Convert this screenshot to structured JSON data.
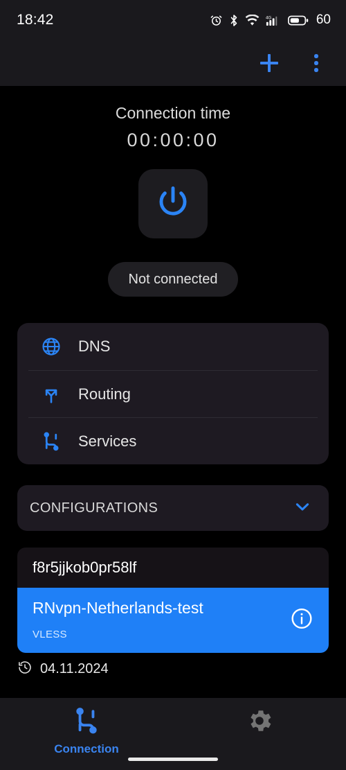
{
  "status_bar": {
    "time": "18:42",
    "battery_percent": "60",
    "icons": [
      "alarm-icon",
      "bluetooth-icon",
      "wifi-icon",
      "cellular-4g-icon",
      "battery-icon"
    ]
  },
  "app_bar": {
    "add_label": "+",
    "add_icon": "plus-icon",
    "overflow_icon": "kebab-menu-icon"
  },
  "connection": {
    "time_label": "Connection time",
    "time_value": "00:00:00",
    "power_icon": "power-icon",
    "status_text": "Not connected"
  },
  "menu": {
    "items": [
      {
        "label": "DNS",
        "icon": "globe-icon"
      },
      {
        "label": "Routing",
        "icon": "route-split-icon"
      },
      {
        "label": "Services",
        "icon": "cable-connection-icon"
      }
    ]
  },
  "configurations": {
    "header_label": "CONFIGURATIONS",
    "expand_icon": "chevron-down-icon",
    "items": [
      {
        "title": "f8r5jjkob0pr58lf",
        "protocol": "",
        "selected": false
      },
      {
        "title": "RNvpn-Netherlands-test",
        "protocol": "VLESS",
        "selected": true,
        "info_icon": "info-circle-icon"
      }
    ],
    "history": {
      "icon": "history-clock-icon",
      "date": "04.11.2024"
    }
  },
  "bottom_nav": {
    "items": [
      {
        "label": "Connection",
        "icon": "cable-connection-icon",
        "active": true
      },
      {
        "label": "",
        "icon": "gear-icon",
        "active": false
      }
    ]
  },
  "colors": {
    "accent_blue": "#3a84f0",
    "selected_blue": "#1f80f7",
    "card_bg": "#1e1a22",
    "bar_bg": "#1a191d",
    "page_bg": "#000000"
  }
}
